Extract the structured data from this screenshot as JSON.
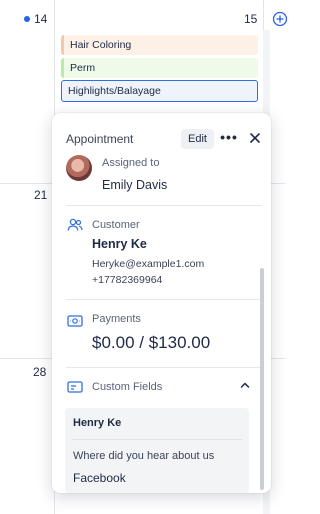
{
  "calendar": {
    "days": {
      "d14": "14",
      "d15": "15",
      "d21": "21",
      "d28": "28"
    },
    "events": [
      {
        "label": "Hair Coloring"
      },
      {
        "label": "Perm"
      },
      {
        "label": "Highlights/Balayage"
      }
    ],
    "accent": "#2563eb"
  },
  "popup": {
    "title": "Appointment",
    "edit_label": "Edit",
    "more_label": "•••",
    "assigned": {
      "label": "Assigned to",
      "name": "Emily Davis"
    },
    "customer": {
      "label": "Customer",
      "name": "Henry Ke",
      "email": "Heryke@example1.com",
      "phone": "+17782369964"
    },
    "payments": {
      "label": "Payments",
      "amount": "$0.00 / $130.00"
    },
    "custom_fields": {
      "label": "Custom Fields",
      "name": "Henry Ke",
      "question": "Where did you hear about us",
      "answer": "Facebook"
    }
  },
  "icons": {
    "add": "plus-circle-icon",
    "close": "close-icon",
    "customer": "users-icon",
    "payments": "payment-icon",
    "custom_fields": "custom-fields-icon",
    "chevron": "chevron-up-icon"
  }
}
